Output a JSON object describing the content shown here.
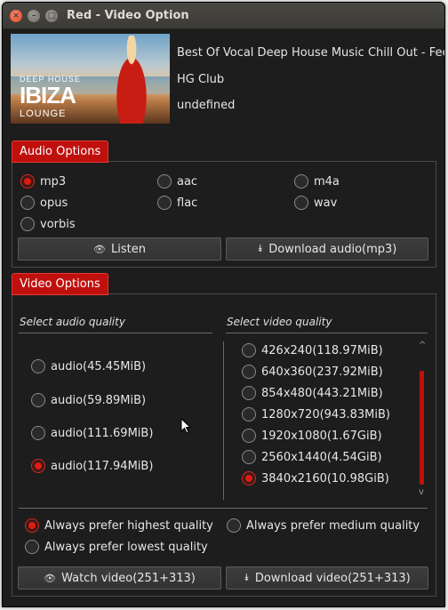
{
  "window": {
    "title": "Red - Video Option",
    "close_glyph": "×",
    "min_glyph": "–",
    "max_glyph": "□"
  },
  "thumbnail": {
    "text_top": "DEEP HOUSE",
    "text_main": "IBIZA",
    "text_bottom": "LOUNGE"
  },
  "video_info": {
    "title": "Best Of Vocal Deep House Music Chill Out - Feeli...",
    "channel": "HG Club",
    "extra": "undefined"
  },
  "audio_options": {
    "tab_label": "Audio Options",
    "formats": [
      {
        "label": "mp3",
        "selected": true
      },
      {
        "label": "aac",
        "selected": false
      },
      {
        "label": "m4a",
        "selected": false
      },
      {
        "label": "opus",
        "selected": false
      },
      {
        "label": "flac",
        "selected": false
      },
      {
        "label": "wav",
        "selected": false
      },
      {
        "label": "vorbis",
        "selected": false
      }
    ],
    "listen_label": "Listen",
    "download_label": "Download audio(mp3)"
  },
  "video_options": {
    "tab_label": "Video Options",
    "audio_quality_heading": "Select audio quality",
    "video_quality_heading": "Select video quality",
    "audio_qualities": [
      {
        "label": "audio(45.45MiB)",
        "selected": false
      },
      {
        "label": "audio(59.89MiB)",
        "selected": false
      },
      {
        "label": "audio(111.69MiB)",
        "selected": false
      },
      {
        "label": "audio(117.94MiB)",
        "selected": true
      }
    ],
    "video_qualities": [
      {
        "label": "426x240(118.97MiB)",
        "selected": false
      },
      {
        "label": "640x360(237.92MiB)",
        "selected": false
      },
      {
        "label": "854x480(443.21MiB)",
        "selected": false
      },
      {
        "label": "1280x720(943.83MiB)",
        "selected": false
      },
      {
        "label": "1920x1080(1.67GiB)",
        "selected": false
      },
      {
        "label": "2560x1440(4.54GiB)",
        "selected": false
      },
      {
        "label": "3840x2160(10.98GiB)",
        "selected": true
      }
    ],
    "preferences": [
      {
        "label": "Always prefer highest quality",
        "selected": true
      },
      {
        "label": "Always prefer medium quality",
        "selected": false
      },
      {
        "label": "Always prefer lowest quality",
        "selected": false
      }
    ],
    "watch_label": "Watch video(251+313)",
    "download_label": "Download video(251+313)"
  },
  "icons": {
    "eye": "👁",
    "download": "⯯",
    "scroll_up": "^",
    "scroll_down": "v"
  },
  "colors": {
    "accent": "#c0100e",
    "background": "#1d1d1d"
  }
}
